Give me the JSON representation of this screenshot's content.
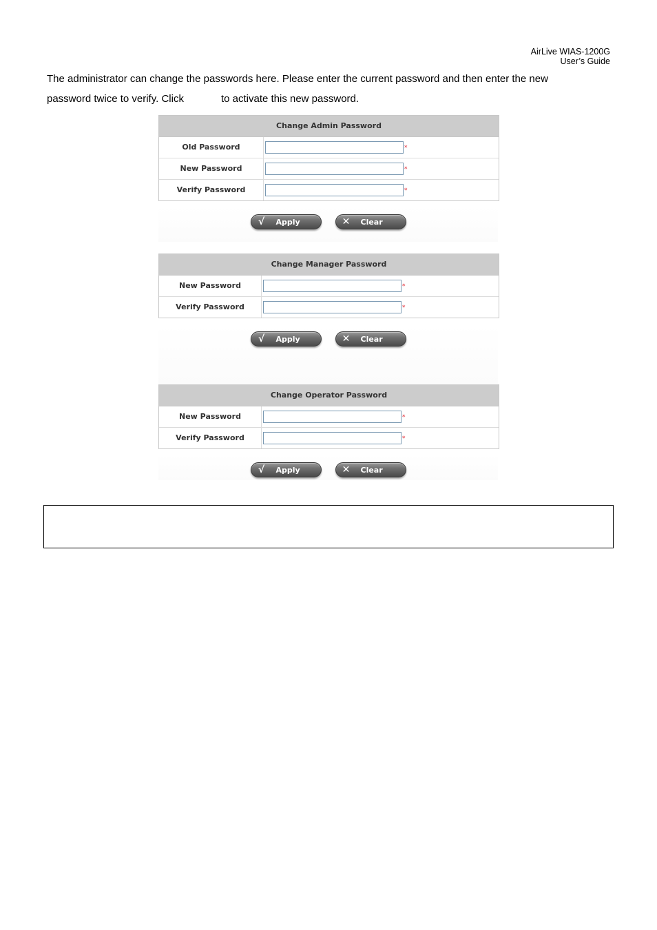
{
  "header": {
    "product": "AirLive  WIAS-1200G",
    "doc": "User’s  Guide"
  },
  "intro": {
    "line1": "The administrator can change the passwords here. Please enter the current password and then enter the new",
    "line2_before": "password twice to verify. Click",
    "line2_after": "to activate this new password."
  },
  "panels": {
    "admin": {
      "title": "Change Admin Password",
      "rows": [
        {
          "label": "Old Password",
          "value": "",
          "required_mark": "*"
        },
        {
          "label": "New Password",
          "value": "",
          "required_mark": "*"
        },
        {
          "label": "Verify Password",
          "value": "",
          "required_mark": "*"
        }
      ]
    },
    "manager": {
      "title": "Change Manager Password",
      "rows": [
        {
          "label": "New Password",
          "value": "",
          "required_mark": "*"
        },
        {
          "label": "Verify Password",
          "value": "",
          "required_mark": "*"
        }
      ]
    },
    "operator": {
      "title": "Change Operator Password",
      "rows": [
        {
          "label": "New Password",
          "value": "",
          "required_mark": "*"
        },
        {
          "label": "Verify Password",
          "value": "",
          "required_mark": "*"
        }
      ]
    }
  },
  "buttons": {
    "apply": {
      "label": "Apply",
      "icon": "check-icon",
      "glyph": "√"
    },
    "clear": {
      "label": "Clear",
      "icon": "x-icon",
      "glyph": "✕"
    }
  },
  "note_box": {
    "text": ""
  }
}
